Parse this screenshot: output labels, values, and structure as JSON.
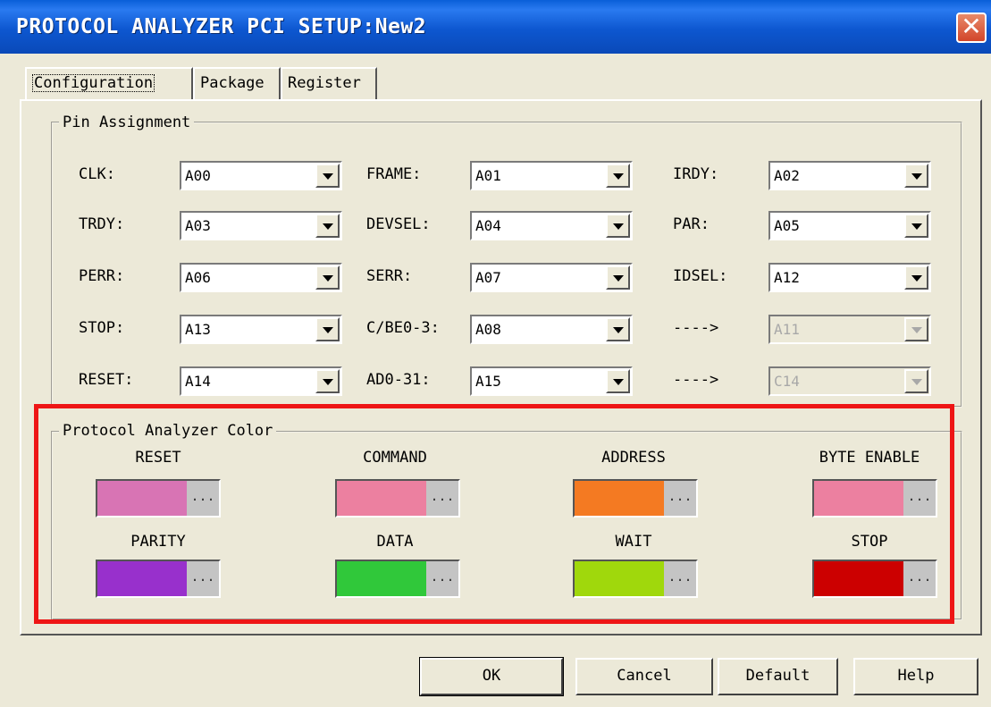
{
  "window": {
    "title": "PROTOCOL ANALYZER PCI SETUP:New2",
    "close_icon": "close-icon"
  },
  "tabs": [
    {
      "label": "Configuration",
      "active": true
    },
    {
      "label": "Package"
    },
    {
      "label": "Register"
    }
  ],
  "pin_assignment": {
    "title": "Pin Assignment",
    "rows": [
      [
        {
          "label": "CLK:",
          "value": "A00"
        },
        {
          "label": "FRAME:",
          "value": "A01"
        },
        {
          "label": "IRDY:",
          "value": "A02"
        }
      ],
      [
        {
          "label": "TRDY:",
          "value": "A03"
        },
        {
          "label": "DEVSEL:",
          "value": "A04"
        },
        {
          "label": "PAR:",
          "value": "A05"
        }
      ],
      [
        {
          "label": "PERR:",
          "value": "A06"
        },
        {
          "label": "SERR:",
          "value": "A07"
        },
        {
          "label": "IDSEL:",
          "value": "A12"
        }
      ],
      [
        {
          "label": "STOP:",
          "value": "A13"
        },
        {
          "label": "C/BE0-3:",
          "value": "A08"
        },
        {
          "label": "---->",
          "value": "A11",
          "disabled": true
        }
      ],
      [
        {
          "label": "RESET:",
          "value": "A14"
        },
        {
          "label": "AD0-31:",
          "value": "A15"
        },
        {
          "label": "---->",
          "value": "C14",
          "disabled": true
        }
      ]
    ]
  },
  "color_group": {
    "title": "Protocol Analyzer Color",
    "dots": "...",
    "items": [
      {
        "label": "RESET",
        "color": "#d874b4"
      },
      {
        "label": "COMMAND",
        "color": "#ec80a0"
      },
      {
        "label": "ADDRESS",
        "color": "#f47a22"
      },
      {
        "label": "BYTE ENABLE",
        "color": "#ec80a0"
      },
      {
        "label": "PARITY",
        "color": "#9830cc"
      },
      {
        "label": "DATA",
        "color": "#30c83a"
      },
      {
        "label": "WAIT",
        "color": "#a0d80c"
      },
      {
        "label": "STOP",
        "color": "#cc0000"
      }
    ]
  },
  "buttons": {
    "ok": "OK",
    "cancel": "Cancel",
    "default": "Default",
    "help": "Help"
  }
}
